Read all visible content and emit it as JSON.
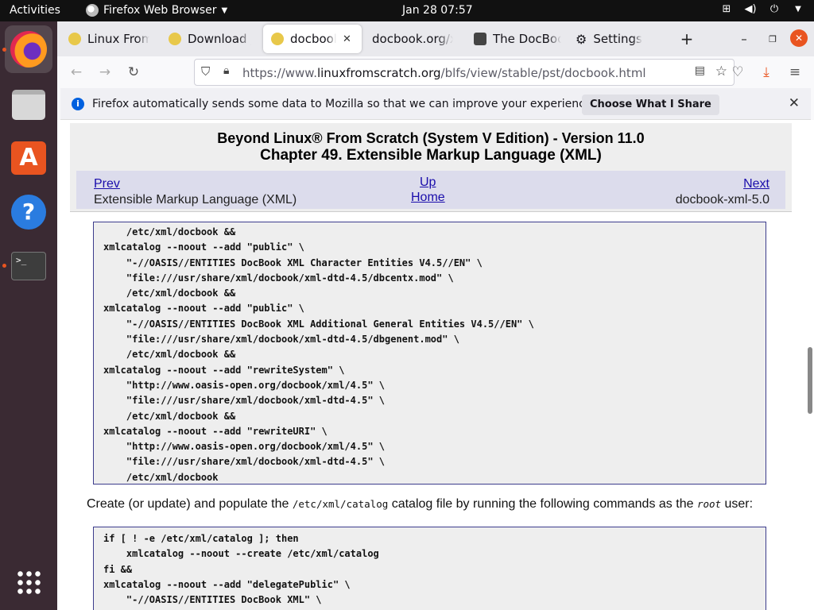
{
  "topbar": {
    "activities": "Activities",
    "app_menu": "Firefox Web Browser",
    "clock": "Jan 28  07:57"
  },
  "dock": {
    "items": [
      "firefox-icon",
      "files-icon",
      "app-store-icon",
      "help-icon",
      "terminal-icon",
      "app-grid-icon"
    ]
  },
  "tabs": [
    {
      "label": "Linux From Scratch"
    },
    {
      "label": "Download jh"
    },
    {
      "label": "docbook-xml"
    },
    {
      "label": "docbook.org/xml"
    },
    {
      "label": "The DocBook"
    },
    {
      "label": "Settings"
    }
  ],
  "urlbar": {
    "prefix": "https://www.",
    "domain": "linuxfromscratch.org",
    "path": "/blfs/view/stable/pst/docbook.html"
  },
  "infobar": {
    "message": "Firefox automatically sends some data to Mozilla so that we can improve your experience.",
    "button": "Choose What I Share"
  },
  "page": {
    "title_line1": "Beyond Linux® From Scratch (System V Edition) - Version 11.0",
    "title_line2": "Chapter 49. Extensible Markup Language (XML)",
    "nav": {
      "prev": "Prev",
      "prev_title": "Extensible Markup Language (XML)",
      "up": "Up",
      "home": "Home",
      "next": "Next",
      "next_title": "docbook-xml-5.0"
    },
    "code_block_1": "    /etc/xml/docbook &&\nxmlcatalog --noout --add \"public\" \\\n    \"-//OASIS//ENTITIES DocBook XML Character Entities V4.5//EN\" \\\n    \"file:///usr/share/xml/docbook/xml-dtd-4.5/dbcentx.mod\" \\\n    /etc/xml/docbook &&\nxmlcatalog --noout --add \"public\" \\\n    \"-//OASIS//ENTITIES DocBook XML Additional General Entities V4.5//EN\" \\\n    \"file:///usr/share/xml/docbook/xml-dtd-4.5/dbgenent.mod\" \\\n    /etc/xml/docbook &&\nxmlcatalog --noout --add \"rewriteSystem\" \\\n    \"http://www.oasis-open.org/docbook/xml/4.5\" \\\n    \"file:///usr/share/xml/docbook/xml-dtd-4.5\" \\\n    /etc/xml/docbook &&\nxmlcatalog --noout --add \"rewriteURI\" \\\n    \"http://www.oasis-open.org/docbook/xml/4.5\" \\\n    \"file:///usr/share/xml/docbook/xml-dtd-4.5\" \\\n    /etc/xml/docbook",
    "para_before": "Create (or update) and populate the ",
    "para_code": "/etc/xml/catalog",
    "para_middle": " catalog file by running the following commands as the ",
    "para_em": "root",
    "para_after": " user:",
    "code_block_2": "if [ ! -e /etc/xml/catalog ]; then\n    xmlcatalog --noout --create /etc/xml/catalog\nfi &&\nxmlcatalog --noout --add \"delegatePublic\" \\\n    \"-//OASIS//ENTITIES DocBook XML\" \\"
  }
}
